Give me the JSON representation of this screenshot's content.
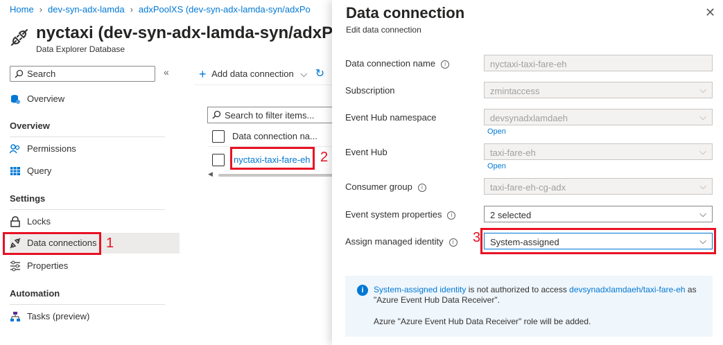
{
  "breadcrumb": [
    "Home",
    "dev-syn-adx-lamda",
    "adxPoolXS (dev-syn-adx-lamda-syn/adxPo"
  ],
  "resource": {
    "title": "nyctaxi (dev-syn-adx-lamda-syn/adxPo",
    "subtitle": "Data Explorer Database"
  },
  "nav": {
    "search_placeholder": "Search",
    "collapse": "«",
    "overview_item": "Overview",
    "sections": [
      {
        "heading": "Overview",
        "items": [
          "Permissions",
          "Query"
        ]
      },
      {
        "heading": "Settings",
        "items": [
          "Locks",
          "Data connections",
          "Properties"
        ]
      },
      {
        "heading": "Automation",
        "items": [
          "Tasks (preview)"
        ]
      }
    ]
  },
  "middle": {
    "add_label": "Add data connection",
    "filter_placeholder": "Search to filter items...",
    "column_header": "Data connection na...",
    "rows": [
      "nyctaxi-taxi-fare-eh"
    ]
  },
  "annotations": {
    "one": "1",
    "two": "2",
    "three": "3"
  },
  "panel": {
    "title": "Data connection",
    "subtitle": "Edit data connection",
    "close": "✕",
    "fields": {
      "name": {
        "label": "Data connection name",
        "value": "nyctaxi-taxi-fare-eh"
      },
      "subscription": {
        "label": "Subscription",
        "value": "zmintaccess"
      },
      "namespace": {
        "label": "Event Hub namespace",
        "value": "devsynadxlamdaeh",
        "link": "Open"
      },
      "eventhub": {
        "label": "Event Hub",
        "value": "taxi-fare-eh",
        "link": "Open"
      },
      "consumer": {
        "label": "Consumer group",
        "value": "taxi-fare-eh-cg-adx"
      },
      "sysprops": {
        "label": "Event system properties",
        "value": "2 selected"
      },
      "identity": {
        "label": "Assign managed identity",
        "value": "System-assigned"
      }
    },
    "info": {
      "link1": "System-assigned identity",
      "text1": " is not authorized to access ",
      "link2": "devsynadxlamdaeh/taxi-fare-eh",
      "text2": " as \"Azure Event Hub Data Receiver\".",
      "line2": "Azure \"Azure Event Hub Data Receiver\" role will be added."
    }
  },
  "colors": {
    "accent": "#0078d4",
    "annotation_red": "#e81123"
  }
}
